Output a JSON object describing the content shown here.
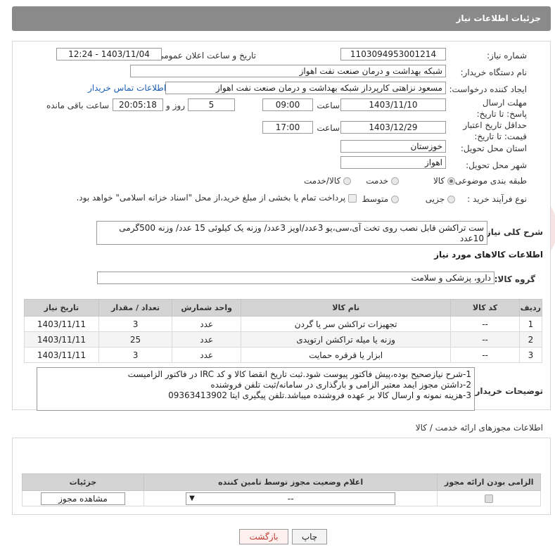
{
  "header": {
    "title": "جزئیات اطلاعات نیاز"
  },
  "form": {
    "need_number_label": "شماره نیاز:",
    "need_number": "1103094953001214",
    "announce_label": "تاریخ و ساعت اعلان عمومی:",
    "announce_value": "1403/11/04 - 12:24",
    "buyer_org_label": "نام دستگاه خریدار:",
    "buyer_org": "شبکه بهداشت و درمان صنعت نفت اهواز",
    "creator_label": "ایجاد کننده درخواست:",
    "creator": "مسعود نزاهتی کارپرداز شبکه بهداشت و درمان صنعت نفت اهواز",
    "contact_link": "اطلاعات تماس خریدار",
    "reply_deadline_label": "مهلت ارسال پاسخ: تا تاریخ:",
    "reply_date": "1403/11/10",
    "time_label": "ساعت",
    "reply_time": "09:00",
    "days_value": "5",
    "days_label": "روز و",
    "remaining_time": "20:05:18",
    "remaining_label": "ساعت باقی مانده",
    "price_validity_label": "حداقل تاریخ اعتبار قیمت: تا تاریخ:",
    "price_date": "1403/12/29",
    "price_time": "17:00",
    "province_label": "استان محل تحویل:",
    "province": "خوزستان",
    "city_label": "شهر محل تحویل:",
    "city": "اهواز",
    "category_label": "طبقه بندی موضوعی:",
    "category_options": [
      "کالا",
      "خدمت",
      "کالا/خدمت"
    ],
    "process_label": "نوع فرآیند خرید :",
    "process_options": [
      "جزیی",
      "متوسط"
    ],
    "payment_note": "پرداخت تمام یا بخشی از مبلغ خرید،از محل \"اسناد خزانه اسلامی\" خواهد بود.",
    "summary_label": "شرح کلی نیاز:",
    "summary_line1": "ست تراکشن قابل نصب روی تخت آی،سی،یو   3عدد/اویز 3عدد/ وزنه یک کیلوئی 15 عدد/ وزنه 500گرمی",
    "summary_line2": "10عدد"
  },
  "goods": {
    "section_title": "اطلاعات کالاهای مورد نیاز",
    "group_label": "گروه کالا:",
    "group_value": "دارو، پزشکی و سلامت",
    "columns": [
      "ردیف",
      "کد کالا",
      "نام کالا",
      "واحد شمارش",
      "تعداد / مقدار",
      "تاریخ نیاز"
    ],
    "rows": [
      [
        "1",
        "--",
        "تجهیزات تراکشن سر یا گردن",
        "عدد",
        "3",
        "1403/11/11"
      ],
      [
        "2",
        "--",
        "وزنه یا میله تراکشن ارتوپدی",
        "عدد",
        "25",
        "1403/11/11"
      ],
      [
        "3",
        "--",
        "ابزار یا قرقره حمایت",
        "عدد",
        "3",
        "1403/11/11"
      ]
    ]
  },
  "buyer_notes": {
    "label": "توضیحات خریدار:",
    "line1": "1-شرح نیازصحیح بوده،پیش فاکتور پیوست شود.ثبت تاریخ انقضا کالا و کد IRC در فاکتور الزامیست",
    "line2": "2-داشتن مجوز ایمد معتبر الزامی و بارگذاری در سامانه/ثبت تلفن فروشنده",
    "line3": "3-هزینه نمونه و ارسال کالا بر عهده فروشنده میباشد.تلفن پیگیری ایتا 09363413902"
  },
  "permits": {
    "section_title": "اطلاعات مجوزهای ارائه خدمت / کالا",
    "columns": [
      "الزامی بودن ارائه مجوز",
      "اعلام وضعیت مجوز توسط تامین کننده",
      "جزئیات"
    ],
    "status_value": "--",
    "view_button": "مشاهده مجوز"
  },
  "footer": {
    "print_button": "چاپ",
    "back_button": "بازگشت"
  }
}
